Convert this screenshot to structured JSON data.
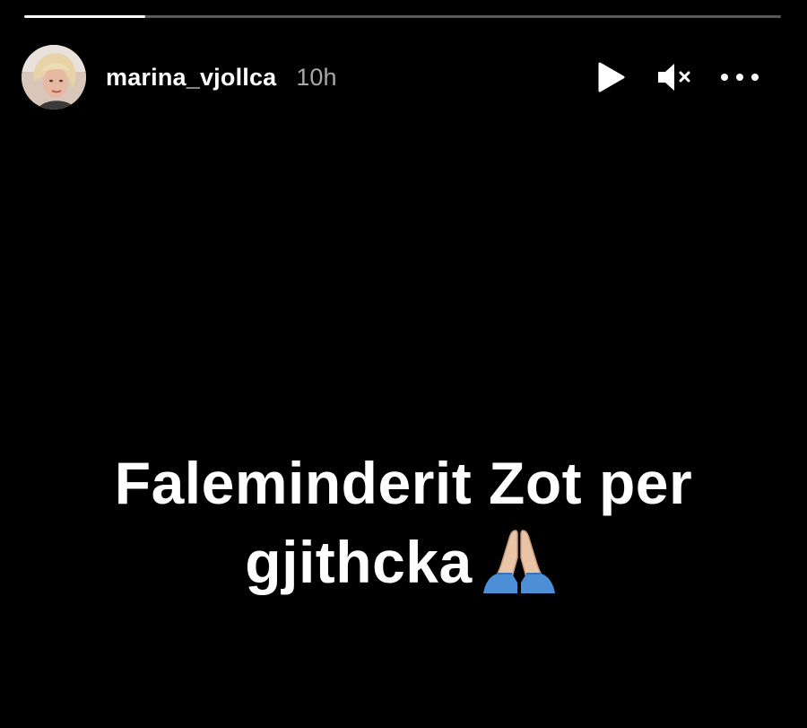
{
  "story": {
    "progress": 0.16,
    "username": "marina_vjollca",
    "timestamp": "10h",
    "caption_line1": "Faleminderit Zot per",
    "caption_line2": "gjithcka"
  },
  "controls": {
    "play_icon": "play-icon",
    "mute_icon": "speaker-muted-icon",
    "more_icon": "more-options-icon"
  },
  "colors": {
    "background": "#000000",
    "text": "#ffffff",
    "timestamp": "#a8a8a8",
    "progress_track": "#595959",
    "progress_fill": "#ffffff"
  }
}
